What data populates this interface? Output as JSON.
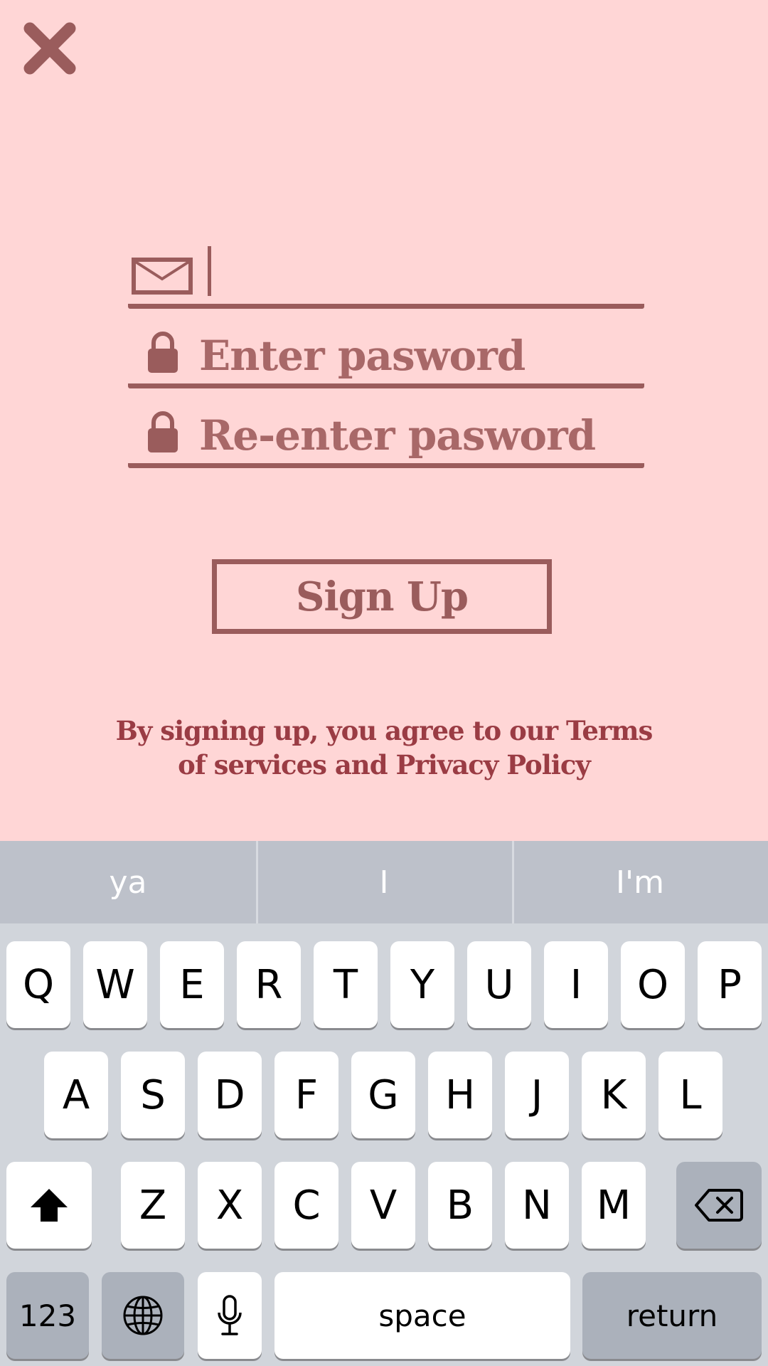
{
  "form": {
    "email_placeholder": "",
    "password_placeholder": "Enter pasword",
    "reenter_placeholder": "Re-enter pasword",
    "signup_label": "Sign Up",
    "terms_text": "By signing up, you agree to our Terms of services and Privacy Policy"
  },
  "keyboard": {
    "suggestions": [
      "ya",
      "I",
      "I'm"
    ],
    "row1": [
      "Q",
      "W",
      "E",
      "R",
      "T",
      "Y",
      "U",
      "I",
      "O",
      "P"
    ],
    "row2": [
      "A",
      "S",
      "D",
      "F",
      "G",
      "H",
      "J",
      "K",
      "L"
    ],
    "row3": [
      "Z",
      "X",
      "C",
      "V",
      "B",
      "N",
      "M"
    ],
    "numbers_label": "123",
    "space_label": "space",
    "return_label": "return"
  },
  "colors": {
    "background": "#ffd6d6",
    "accent": "#9a5c5c",
    "terms_text": "#9a3c44",
    "keyboard_bg": "#d1d5db",
    "suggest_bg": "#bdc1ca",
    "dark_key": "#abb1bb"
  },
  "icons": {
    "close": "close-icon",
    "email": "envelope-icon",
    "password": "lock-icon",
    "shift": "shift-icon",
    "delete": "backspace-icon",
    "globe": "globe-icon",
    "mic": "microphone-icon"
  }
}
